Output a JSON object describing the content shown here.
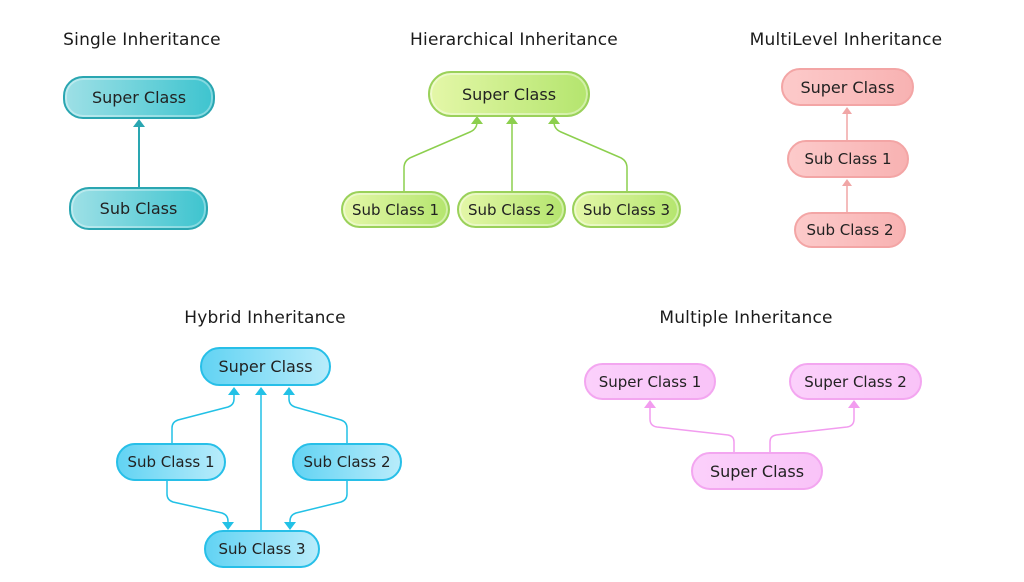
{
  "diagrams": {
    "single": {
      "title": "Single Inheritance",
      "nodes": {
        "super": "Super Class",
        "sub": "Sub Class"
      },
      "color": "#2aa6b1"
    },
    "hierarchical": {
      "title": "Hierarchical Inheritance",
      "nodes": {
        "super": "Super Class",
        "sub1": "Sub Class 1",
        "sub2": "Sub Class 2",
        "sub3": "Sub Class 3"
      },
      "color": "#8ccf4e"
    },
    "multilevel": {
      "title": "MultiLevel Inheritance",
      "nodes": {
        "super": "Super Class",
        "sub1": "Sub Class 1",
        "sub2": "Sub Class 2"
      },
      "color": "#f0a6a6"
    },
    "hybrid": {
      "title": "Hybrid Inheritance",
      "nodes": {
        "super": "Super Class",
        "sub1": "Sub Class 1",
        "sub2": "Sub Class 2",
        "sub3": "Sub Class 3"
      },
      "color": "#22c1e6"
    },
    "multiple": {
      "title": "Multiple Inheritance",
      "nodes": {
        "super1": "Super Class 1",
        "super2": "Super Class 2",
        "child": "Super Class"
      },
      "color": "#f29cef"
    }
  }
}
